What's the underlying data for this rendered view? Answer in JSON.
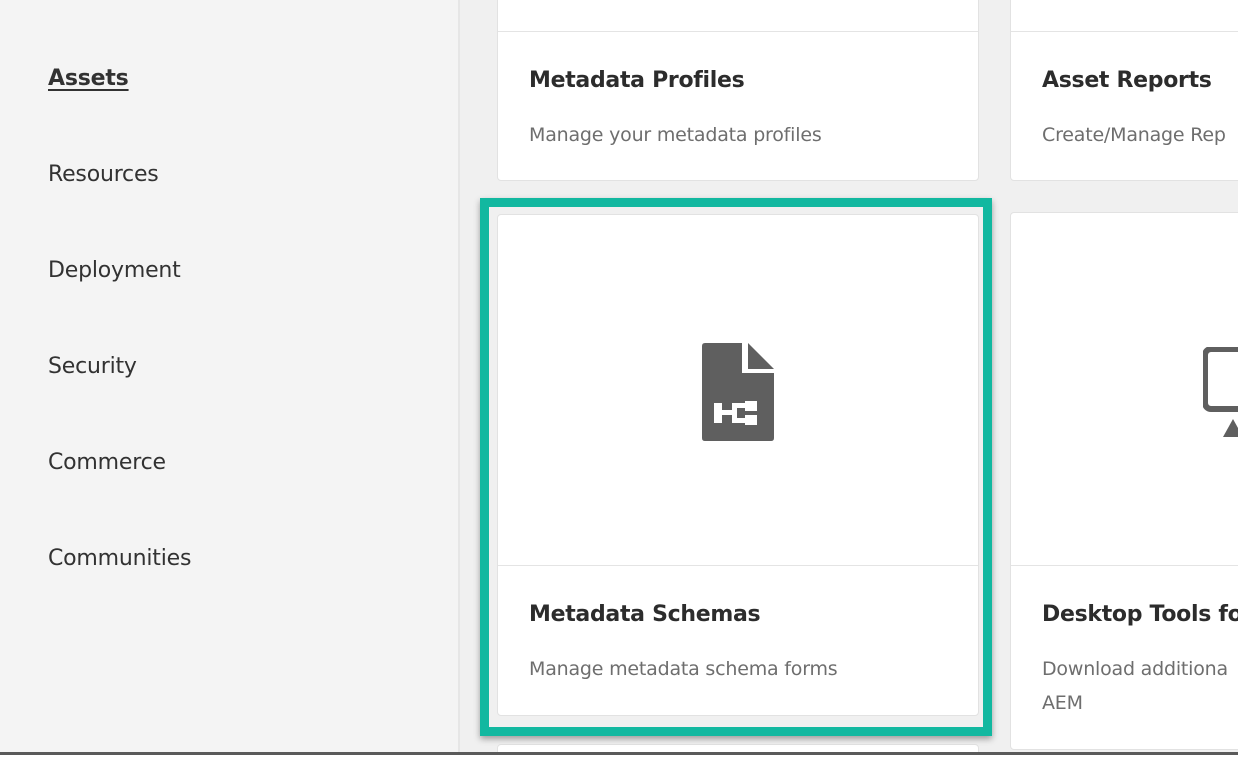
{
  "sidebar": {
    "items": [
      {
        "label": "Assets",
        "active": true
      },
      {
        "label": "Resources"
      },
      {
        "label": "Deployment"
      },
      {
        "label": "Security"
      },
      {
        "label": "Commerce"
      },
      {
        "label": "Communities"
      }
    ]
  },
  "cards": {
    "metadata_profiles": {
      "title": "Metadata Profiles",
      "description": "Manage your metadata profiles"
    },
    "asset_reports": {
      "title": "Asset Reports",
      "description": "Create/Manage Rep"
    },
    "metadata_schemas": {
      "title": "Metadata Schemas",
      "description": "Manage metadata schema forms",
      "icon": "schema-document-icon"
    },
    "desktop_tools": {
      "title": "Desktop Tools for",
      "description_line1": "Download additiona",
      "description_line2": "AEM",
      "icon": "desktop-monitor-icon"
    }
  },
  "colors": {
    "highlight": "#12b8a0",
    "icon": "#5f5f5f",
    "sidebar_bg": "#f4f4f4"
  }
}
